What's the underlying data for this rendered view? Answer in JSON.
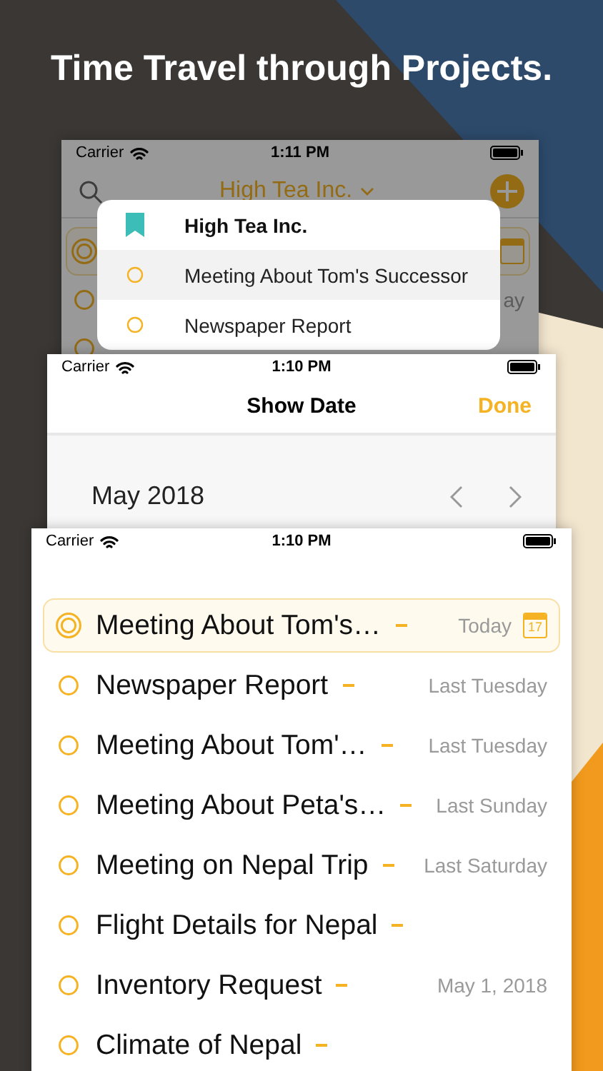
{
  "headline": "Time Travel through Projects.",
  "back_screen": {
    "status_bar": {
      "carrier": "Carrier",
      "time": "1:11 PM"
    },
    "project_title": "High Tea Inc.",
    "rows": [
      {
        "selected": true,
        "calendar": true
      },
      {
        "selected": false,
        "date": "ay"
      },
      {
        "selected": false
      }
    ],
    "menu": [
      {
        "kind": "project",
        "label": "High Tea Inc.",
        "selected": false
      },
      {
        "kind": "task",
        "label": "Meeting About Tom's Successor",
        "selected": true
      },
      {
        "kind": "task",
        "label": "Newspaper Report",
        "selected": false
      }
    ]
  },
  "date_screen": {
    "status_bar": {
      "carrier": "Carrier",
      "time": "1:10 PM"
    },
    "title": "Show Date",
    "done": "Done",
    "month": "May 2018"
  },
  "list_screen": {
    "status_bar": {
      "carrier": "Carrier",
      "time": "1:10 PM"
    },
    "rows": [
      {
        "title": "Meeting About Tom's…",
        "date": "Today",
        "selected": true,
        "calendar_day": "17"
      },
      {
        "title": "Newspaper Report",
        "date": "Last Tuesday",
        "selected": false
      },
      {
        "title": "Meeting About Tom'…",
        "date": "Last Tuesday",
        "selected": false
      },
      {
        "title": "Meeting About Peta's…",
        "date": "Last Sunday",
        "selected": false
      },
      {
        "title": "Meeting on Nepal Trip",
        "date": "Last Saturday",
        "selected": false
      },
      {
        "title": "Flight Details for Nepal",
        "selected": false
      },
      {
        "title": "Inventory Request",
        "date": "May 1, 2018",
        "selected": false
      },
      {
        "title": "Climate of Nepal",
        "selected": false
      }
    ]
  }
}
